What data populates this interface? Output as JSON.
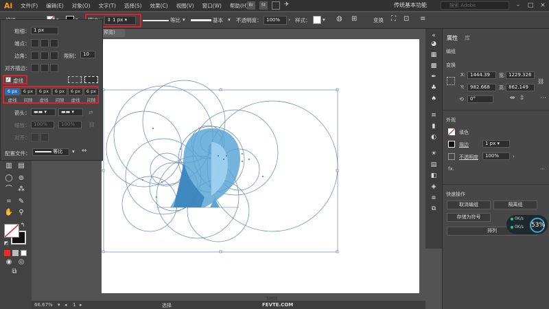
{
  "menubar": {
    "logo": "Ai",
    "items": [
      "文件(F)",
      "编辑(E)",
      "对象(O)",
      "文字(T)",
      "选择(S)",
      "效果(C)",
      "视图(V)",
      "窗口(W)",
      "帮助(H)"
    ],
    "workspace": "传统基本功能",
    "search_placeholder": "搜索 Adobe"
  },
  "controlbar": {
    "selection_label": "编组",
    "stroke_label": "描边：",
    "stroke_value": "1 px",
    "profile_label": "等比",
    "brush_label": "基本",
    "opacity_label": "不透明度：",
    "opacity_value": "100%",
    "style_label": "样式：",
    "transform_label": "变换"
  },
  "stroke_panel": {
    "weight_label": "粗细：",
    "weight_value": "1 px",
    "cap_label": "端点：",
    "corner_label": "边角：",
    "limit_label": "限制：",
    "limit_value": "10",
    "align_label": "对齐描边：",
    "dashed_label": "虚线",
    "dash_values": [
      "6 px",
      "6 px",
      "6 px",
      "6 px",
      "6 px",
      "6 px"
    ],
    "dash_labels": [
      "虚线",
      "间隙",
      "虚线",
      "间隙",
      "虚线",
      "间隙"
    ],
    "arrow_label": "箭头：",
    "scale_label": "缩放：",
    "scale_values": [
      "100%",
      "100%"
    ],
    "align_arrow_label": "对齐：",
    "profile_label": "配置文件：",
    "profile_value": "等比"
  },
  "document": {
    "tab": "预览)",
    "zoom": "66.67%",
    "page": "1",
    "status": "选择",
    "watermark": "FEVTE.COM",
    "watermark_cn": "飞特网"
  },
  "properties": {
    "tab_properties": "属性",
    "tab_library": "库",
    "group_label": "编组",
    "transform_label": "变换",
    "x_label": "X:",
    "x_value": "1444.39",
    "y_label": "Y:",
    "y_value": "982.668",
    "w_label": "宽:",
    "w_value": "1229.326",
    "h_label": "高:",
    "h_value": "862.149",
    "angle_value": "0°",
    "appearance_label": "外观",
    "fill_label": "填色",
    "stroke_label": "描边",
    "stroke_value": "1 px",
    "opacity_label": "不透明度",
    "opacity_value": "100%",
    "fx_label": "fx.",
    "quick_label": "快速操作",
    "btn_ungroup": "取消编组",
    "btn_isolate": "隔离组",
    "btn_symbol": "存储为符号",
    "btn_arrange": "排列"
  },
  "perf_widget": {
    "percent": "53%",
    "up": "0K/s",
    "down": "0K/s"
  },
  "colors": {
    "accent_red": "#e0202a",
    "guide_blue": "#3f6fa8",
    "bird_blue": "#5aa6d6"
  }
}
